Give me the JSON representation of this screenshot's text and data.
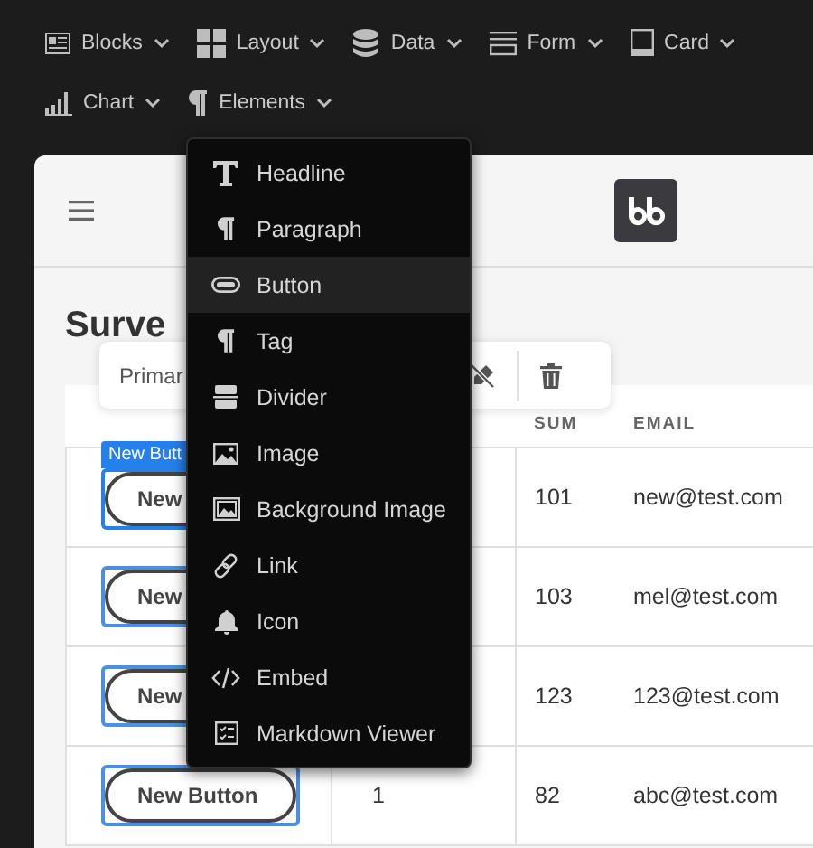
{
  "toolbar": [
    {
      "label": "Blocks"
    },
    {
      "label": "Layout"
    },
    {
      "label": "Data"
    },
    {
      "label": "Form"
    },
    {
      "label": "Card"
    },
    {
      "label": "Chart"
    },
    {
      "label": "Elements"
    }
  ],
  "insert_menu": {
    "items": [
      {
        "label": "Headline",
        "selected": false
      },
      {
        "label": "Paragraph",
        "selected": false
      },
      {
        "label": "Button",
        "selected": true
      },
      {
        "label": "Tag",
        "selected": false
      },
      {
        "label": "Divider",
        "selected": false
      },
      {
        "label": "Image",
        "selected": false
      },
      {
        "label": "Background Image",
        "selected": false
      },
      {
        "label": "Link",
        "selected": false
      },
      {
        "label": "Icon",
        "selected": false
      },
      {
        "label": "Embed",
        "selected": false
      },
      {
        "label": "Markdown Viewer",
        "selected": false
      }
    ]
  },
  "page": {
    "heading": "Surve",
    "component_toolbar": {
      "label": "Primar"
    },
    "table": {
      "columns": [
        {
          "header": "SUM"
        },
        {
          "header": "EMAIL"
        }
      ],
      "rows": [
        {
          "button": "New",
          "selected": true,
          "tag": "New Butt",
          "sum": "101",
          "email": "new@test.com"
        },
        {
          "button": "New",
          "selected": false,
          "sum": "103",
          "email": "mel@test.com"
        },
        {
          "button": "New",
          "selected": false,
          "sum": "123",
          "email": "123@test.com"
        },
        {
          "button": "New Button",
          "selected": false,
          "column_2": "1",
          "sum": "82",
          "email": "abc@test.com"
        }
      ]
    }
  }
}
